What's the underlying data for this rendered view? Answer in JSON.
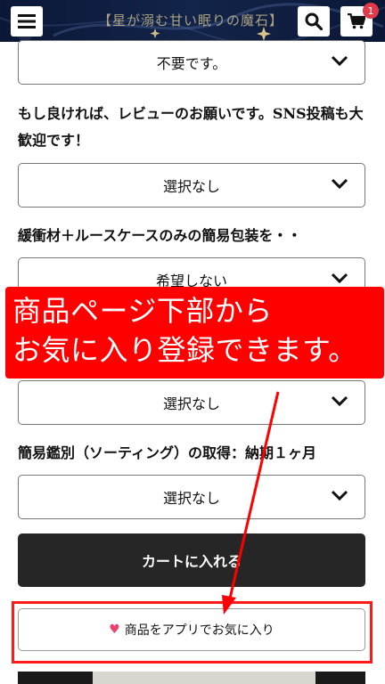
{
  "header": {
    "logo_text": "【星が溺む甘い眠りの魔石】",
    "cart_count": "1",
    "icons": [
      "hamburger-menu-icon",
      "search-icon",
      "cart-icon"
    ],
    "background_color": "#0c1a3a"
  },
  "options": [
    {
      "value": "不要です。"
    },
    {
      "label": "もし良ければ、レビューのお願いです。SNS投稿も大歓迎です！",
      "value": "選択なし"
    },
    {
      "label": "緩衝材＋ルースケースのみの簡易包装を・・",
      "value": "希望しない"
    },
    {
      "value": "選択なし"
    },
    {
      "label": "簡易鑑別（ソーティング）の取得：納期１ヶ月",
      "value": "選択なし"
    }
  ],
  "cart_button_label": "カートに入れる",
  "favorite_button_label": "商品をアプリでお気に入り",
  "callout": {
    "line1": "商品ページ下部から",
    "line2": "お気に入り登録できます。",
    "color": "#ff0000"
  },
  "accent_colors": {
    "heart": "#e9436a",
    "badge": "#e0394a",
    "cart_button": "#262626"
  }
}
